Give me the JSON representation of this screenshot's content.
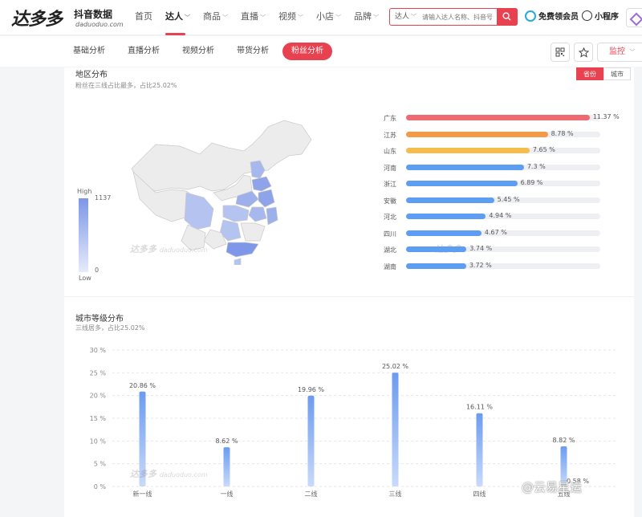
{
  "header": {
    "logo_main": "达多多",
    "logo_sub": "抖音数据",
    "logo_url": "daduoduo.com",
    "nav": [
      {
        "label": "首页",
        "caret": false
      },
      {
        "label": "达人",
        "caret": true
      },
      {
        "label": "商品",
        "caret": true
      },
      {
        "label": "直播",
        "caret": true
      },
      {
        "label": "视频",
        "caret": true
      },
      {
        "label": "小店",
        "caret": true
      },
      {
        "label": "品牌",
        "caret": true
      }
    ],
    "active_nav": 1,
    "search": {
      "type": "达人",
      "placeholder": "请输入达人名称、抖音号"
    },
    "vip_label": "免费领会员",
    "mini_label": "小程序"
  },
  "subnav": {
    "tabs": [
      "基础分析",
      "直播分析",
      "视频分析",
      "带货分析",
      "粉丝分析"
    ],
    "active": 4,
    "monitor_label": "监控"
  },
  "region": {
    "title": "地区分布",
    "subtitle": "粉丝在三线占比最多，占比25.02%",
    "toggle": [
      "省份",
      "城市"
    ],
    "toggle_active": 0,
    "legend_high": "High",
    "legend_low": "Low",
    "legend_max": "1137",
    "legend_min": "0",
    "watermark_main": "达多多",
    "watermark_sub": "daduoduo.com",
    "ranking": [
      {
        "name": "广东",
        "value": 11.37,
        "label": "11.37 %",
        "color": "#ee6a73"
      },
      {
        "name": "江苏",
        "value": 8.78,
        "label": "8.78 %",
        "color": "#f29a47"
      },
      {
        "name": "山东",
        "value": 7.65,
        "label": "7.65 %",
        "color": "#f5bd4e"
      },
      {
        "name": "河南",
        "value": 7.3,
        "label": "7.3 %",
        "color": "#5d9ef3"
      },
      {
        "name": "浙江",
        "value": 6.89,
        "label": "6.89 %",
        "color": "#5d9ef3"
      },
      {
        "name": "安徽",
        "value": 5.45,
        "label": "5.45 %",
        "color": "#5d9ef3"
      },
      {
        "name": "河北",
        "value": 4.94,
        "label": "4.94 %",
        "color": "#5d9ef3"
      },
      {
        "name": "四川",
        "value": 4.67,
        "label": "4.67 %",
        "color": "#5d9ef3"
      },
      {
        "name": "湖北",
        "value": 3.74,
        "label": "3.74 %",
        "color": "#5d9ef3"
      },
      {
        "name": "湖南",
        "value": 3.72,
        "label": "3.72 %",
        "color": "#5d9ef3"
      }
    ]
  },
  "city_level": {
    "title": "城市等级分布",
    "subtitle": "三线居多，占比25.02%"
  },
  "chart_data": {
    "type": "bar",
    "categories": [
      "新一线",
      "一线",
      "二线",
      "三线",
      "四线",
      "五线"
    ],
    "values": [
      20.86,
      8.62,
      19.96,
      25.02,
      16.11,
      8.82
    ],
    "data_labels": [
      "20.86 %",
      "8.62 %",
      "19.96 %",
      "25.02 %",
      "16.11 %",
      "8.82 %"
    ],
    "extra_label": "0.58 %",
    "ylim": [
      0,
      30
    ],
    "yticks": [
      "0 %",
      "5 %",
      "10 %",
      "15 %",
      "20 %",
      "25 %",
      "30 %"
    ],
    "grid": true,
    "bar_color": "#6b9bf0"
  },
  "page_watermark": "@云易星运"
}
